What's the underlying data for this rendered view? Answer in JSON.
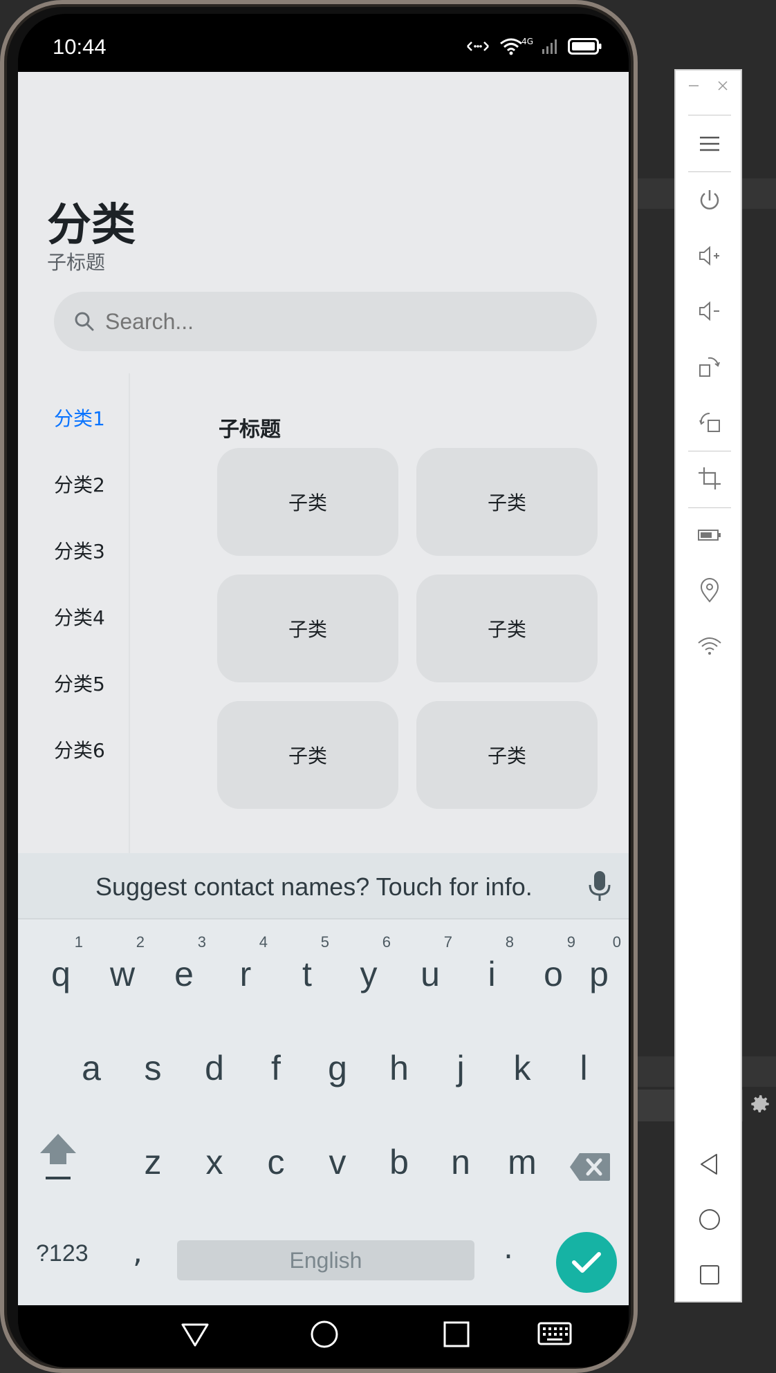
{
  "status_bar": {
    "time": "10:44",
    "network_label": "4G"
  },
  "app": {
    "title": "分类",
    "subtitle": "子标题",
    "search": {
      "placeholder": "Search..."
    },
    "sidebar": {
      "items": [
        {
          "label": "分类1",
          "active": true
        },
        {
          "label": "分类2",
          "active": false
        },
        {
          "label": "分类3",
          "active": false
        },
        {
          "label": "分类4",
          "active": false
        },
        {
          "label": "分类5",
          "active": false
        },
        {
          "label": "分类6",
          "active": false
        }
      ]
    },
    "content": {
      "subtitle": "子标题",
      "cards": [
        "子类",
        "子类",
        "子类",
        "子类",
        "子类",
        "子类"
      ]
    },
    "colors": {
      "active": "#0a74ff",
      "background": "#e9eaec",
      "card": "#dcdee0"
    }
  },
  "keyboard": {
    "suggestion": "Suggest contact names? Touch for info.",
    "row1": [
      {
        "letter": "q",
        "hint": "1"
      },
      {
        "letter": "w",
        "hint": "2"
      },
      {
        "letter": "e",
        "hint": "3"
      },
      {
        "letter": "r",
        "hint": "4"
      },
      {
        "letter": "t",
        "hint": "5"
      },
      {
        "letter": "y",
        "hint": "6"
      },
      {
        "letter": "u",
        "hint": "7"
      },
      {
        "letter": "i",
        "hint": "8"
      },
      {
        "letter": "o",
        "hint": "9"
      },
      {
        "letter": "p",
        "hint": "0"
      }
    ],
    "row2": [
      "a",
      "s",
      "d",
      "f",
      "g",
      "h",
      "j",
      "k",
      "l"
    ],
    "row3": [
      "z",
      "x",
      "c",
      "v",
      "b",
      "n",
      "m"
    ],
    "num_label": "?123",
    "comma": ",",
    "space_label": "English",
    "period": ".",
    "enter_color": "#16b3a4"
  },
  "emulator_panel": {
    "icons": [
      "minimize-icon",
      "close-icon",
      "menu-icon",
      "power-icon",
      "volume-up-icon",
      "volume-down-icon",
      "rotate-right-icon",
      "rotate-left-icon",
      "crop-icon",
      "battery-icon",
      "location-icon",
      "wifi-icon",
      "back-icon",
      "home-icon",
      "overview-icon"
    ]
  }
}
